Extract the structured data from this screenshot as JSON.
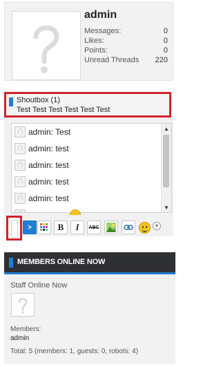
{
  "profile": {
    "username": "admin",
    "stats": [
      {
        "label": "Messages:",
        "value": "0"
      },
      {
        "label": "Likes:",
        "value": "0"
      },
      {
        "label": "Points:",
        "value": "0"
      },
      {
        "label": "Unread Threads",
        "value": "220"
      }
    ]
  },
  "shoutbox": {
    "title": "Shoutbox (1)",
    "subtitle": "Test Test Test Test Test Test",
    "messages": [
      {
        "text": "admin: Test"
      },
      {
        "text": "admin: test"
      },
      {
        "text": "admin: test"
      },
      {
        "text": "admin: test"
      },
      {
        "text": "admin: test"
      }
    ],
    "submit_label": ">",
    "toolbar": {
      "bold": "B",
      "italic": "I",
      "strike": "ABC"
    }
  },
  "members_online": {
    "title": "MEMBERS ONLINE NOW",
    "staff_label": "Staff Online Now",
    "members_label": "Members:",
    "members_list": "admin",
    "total": "Total: 5 (members: 1, guests: 0, robots: 4)"
  },
  "colors": {
    "accent": "#1f7fd3",
    "highlight": "#d1232a",
    "header_bg": "#2f3033"
  }
}
